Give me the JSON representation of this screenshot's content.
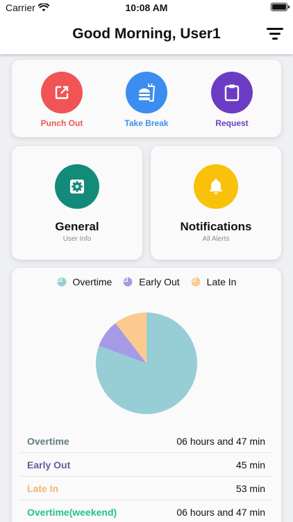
{
  "status_bar": {
    "carrier": "Carrier",
    "time": "10:08 AM"
  },
  "header": {
    "title": "Good Morning, User1"
  },
  "quick_actions": [
    {
      "label": "Punch Out",
      "icon": "external-link-icon",
      "color": "#f05454"
    },
    {
      "label": "Take Break",
      "icon": "fastfood-icon",
      "color": "#3b8ef0"
    },
    {
      "label": "Request",
      "icon": "clipboard-icon",
      "color": "#6b3cc3"
    }
  ],
  "tiles": {
    "general": {
      "title": "General",
      "subtitle": "User Info",
      "icon": "settings-icon",
      "color": "#148a7a"
    },
    "notifications": {
      "title": "Notifications",
      "subtitle": "All Alerts",
      "icon": "bell-icon",
      "color": "#f9c109"
    }
  },
  "chart_data": {
    "type": "pie",
    "legend_position": "top",
    "slices": [
      {
        "label": "Overtime",
        "value": 407,
        "color": "#97ced6"
      },
      {
        "label": "Early Out",
        "value": 45,
        "color": "#a59ae6"
      },
      {
        "label": "Late In",
        "value": 53,
        "color": "#fcca8e"
      }
    ]
  },
  "stats": [
    {
      "label": "Overtime",
      "value": "06 hours and 47 min",
      "color": "#5e7d80"
    },
    {
      "label": "Early Out",
      "value": "45 min",
      "color": "#6a5a9a"
    },
    {
      "label": "Late In",
      "value": "53 min",
      "color": "#f5b56d"
    },
    {
      "label": "Overtime(weekend)",
      "value": "06 hours and 47 min",
      "color": "#20c290"
    }
  ]
}
